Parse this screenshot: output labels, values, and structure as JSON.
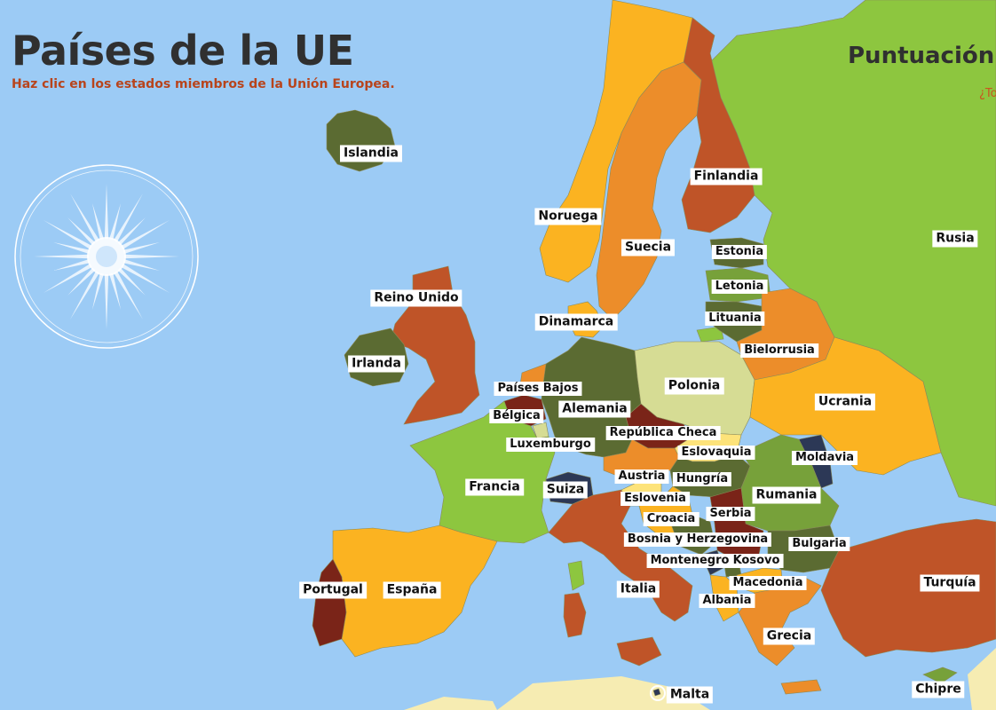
{
  "header": {
    "title": "Países de la UE",
    "subtitle": "Haz clic en los estados miembros de la Unión Europea."
  },
  "score": {
    "label": "Puntuación",
    "hint": "¿To"
  },
  "icons": {
    "emblem": "sun-star-emblem-icon",
    "malta_marker": "circle-marker-icon"
  },
  "colors": {
    "sea": "#9ccbf5",
    "title": "#303030",
    "subtitle": "#b8441c",
    "hint": "#c9561f",
    "label_bg": "#ffffff",
    "orange_light": "#fbb321",
    "orange": "#ec8d2a",
    "rust": "#bf5428",
    "green_bright": "#8dc63f",
    "olive_dark": "#5b6b32",
    "olive_light": "#d6dc94",
    "green_mid": "#77a13a",
    "maroon": "#7a2418",
    "navy": "#2c3856",
    "yellow": "#fde37a",
    "sand": "#f6ecb2"
  },
  "countries": [
    {
      "id": "islandia",
      "label": "Islandia"
    },
    {
      "id": "noruega",
      "label": "Noruega"
    },
    {
      "id": "suecia",
      "label": "Suecia"
    },
    {
      "id": "finlandia",
      "label": "Finlandia"
    },
    {
      "id": "rusia",
      "label": "Rusia"
    },
    {
      "id": "estonia",
      "label": "Estonia"
    },
    {
      "id": "letonia",
      "label": "Letonia"
    },
    {
      "id": "lituania",
      "label": "Lituania"
    },
    {
      "id": "reino-unido",
      "label": "Reino Unido"
    },
    {
      "id": "irlanda",
      "label": "Irlanda"
    },
    {
      "id": "dinamarca",
      "label": "Dinamarca"
    },
    {
      "id": "bielorrusia",
      "label": "Bielorrusia"
    },
    {
      "id": "paises-bajos",
      "label": "Países Bajos"
    },
    {
      "id": "polonia",
      "label": "Polonia"
    },
    {
      "id": "belgica",
      "label": "Bélgica"
    },
    {
      "id": "alemania",
      "label": "Alemania"
    },
    {
      "id": "ucrania",
      "label": "Ucrania"
    },
    {
      "id": "republica-checa",
      "label": "República Checa"
    },
    {
      "id": "luxemburgo",
      "label": "Luxemburgo"
    },
    {
      "id": "eslovaquia",
      "label": "Eslovaquia"
    },
    {
      "id": "moldavia",
      "label": "Moldavia"
    },
    {
      "id": "austria",
      "label": "Austria"
    },
    {
      "id": "hungria",
      "label": "Hungría"
    },
    {
      "id": "francia",
      "label": "Francia"
    },
    {
      "id": "suiza",
      "label": "Suiza"
    },
    {
      "id": "rumania",
      "label": "Rumania"
    },
    {
      "id": "eslovenia",
      "label": "Eslovenia"
    },
    {
      "id": "serbia",
      "label": "Serbia"
    },
    {
      "id": "croacia",
      "label": "Croacia"
    },
    {
      "id": "bosnia-y-herzegovina",
      "label": "Bosnia y Herzegovina"
    },
    {
      "id": "bulgaria",
      "label": "Bulgaria"
    },
    {
      "id": "montenegro",
      "label": "Montenegro"
    },
    {
      "id": "kosovo",
      "label": "Kosovo"
    },
    {
      "id": "portugal",
      "label": "Portugal"
    },
    {
      "id": "espana",
      "label": "España"
    },
    {
      "id": "macedonia",
      "label": "Macedonia"
    },
    {
      "id": "turquia",
      "label": "Turquía"
    },
    {
      "id": "italia",
      "label": "Italia"
    },
    {
      "id": "albania",
      "label": "Albania"
    },
    {
      "id": "grecia",
      "label": "Grecia"
    },
    {
      "id": "chipre",
      "label": "Chipre"
    },
    {
      "id": "malta",
      "label": "Malta"
    }
  ]
}
